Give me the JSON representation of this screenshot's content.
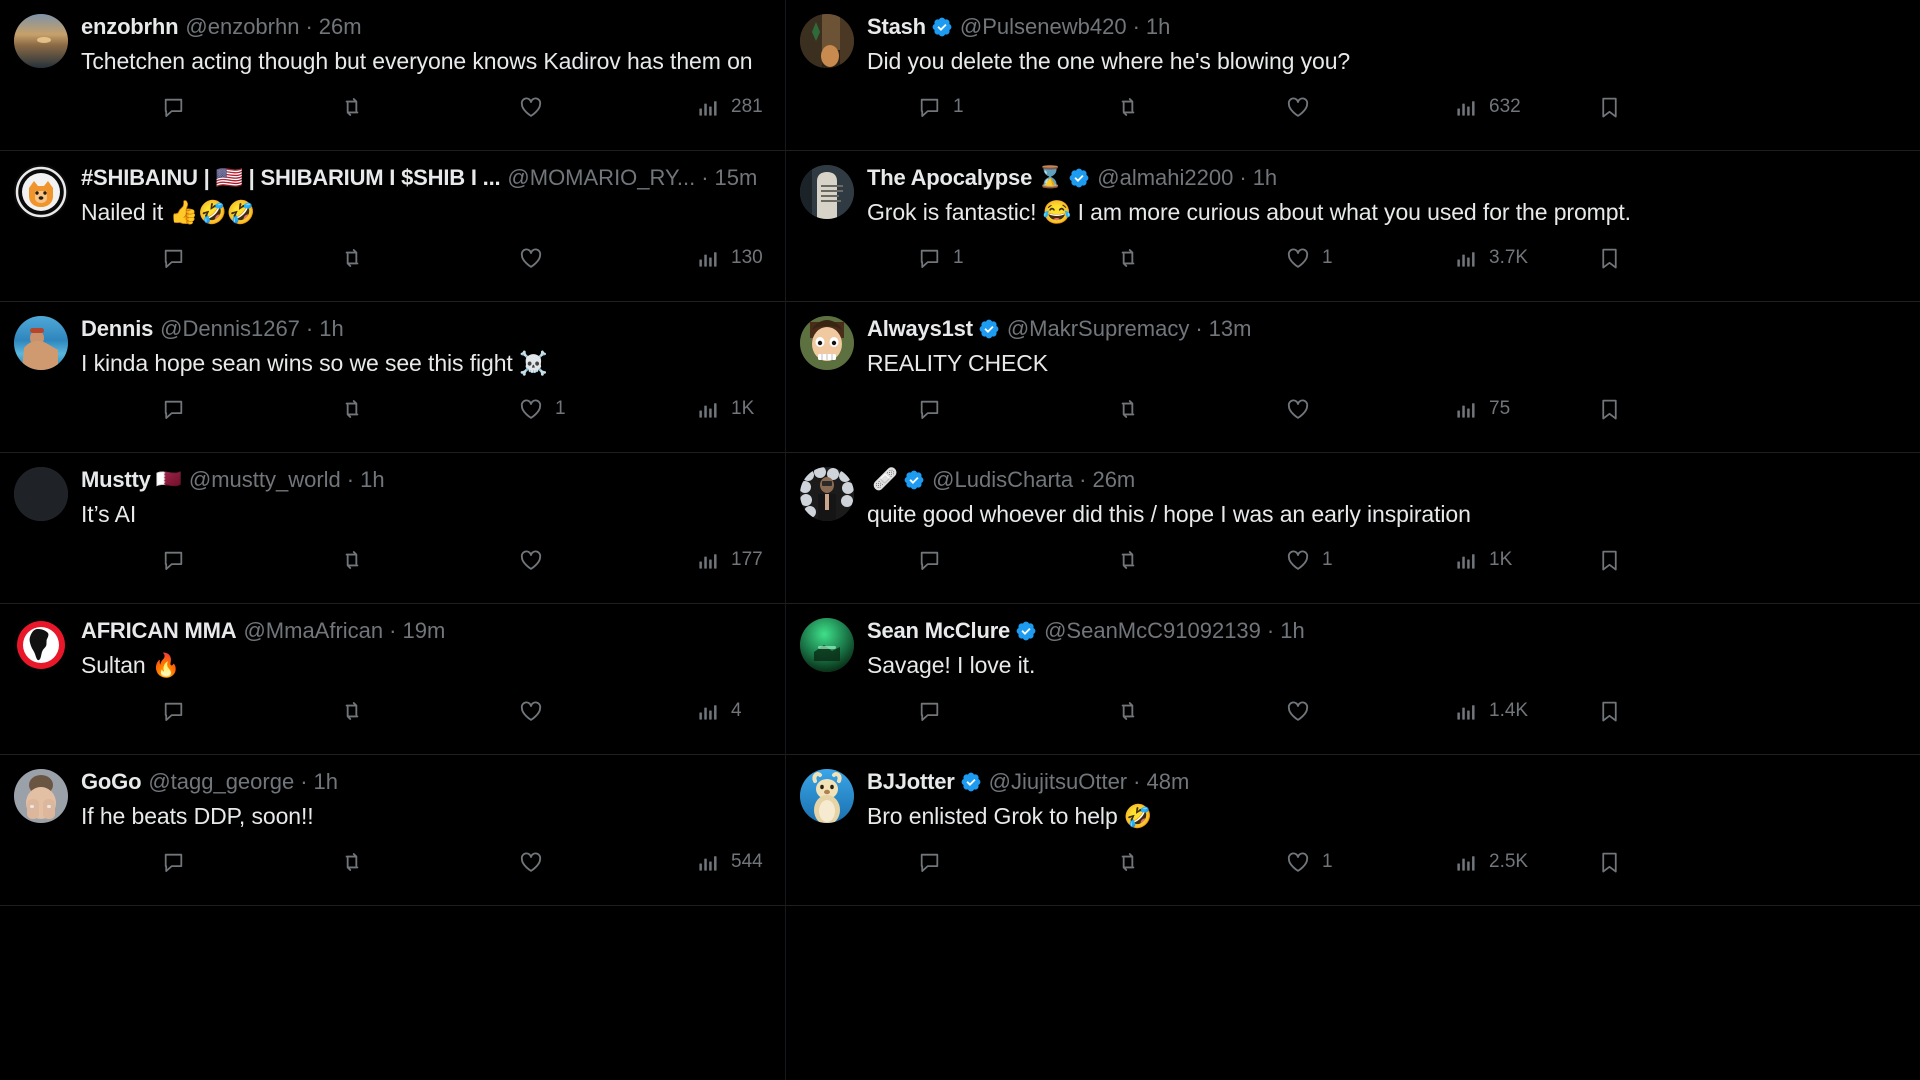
{
  "app": {
    "name": "x-timeline-replies",
    "theme": "dark",
    "accent_verified": "#1d9bf0",
    "text_primary": "#e7e9ea",
    "text_muted": "#71767b",
    "divider": "#1d1f23",
    "background": "#000000"
  },
  "icons": {
    "reply": "reply-icon",
    "retweet": "retweet-icon",
    "like": "heart-icon",
    "views": "analytics-bars-icon",
    "bookmark": "bookmark-icon",
    "verified": "verified-badge-icon",
    "close": "x-logo-icon"
  },
  "left_panel": {
    "name": "left-timeline-column",
    "tweets": [
      {
        "display_name": "enzobrhn",
        "name_emoji": "",
        "verified": false,
        "handle": "@enzobrhn",
        "time": "26m",
        "text": "Tchetchen acting though but everyone knows Kadirov has them on",
        "reply_count": "",
        "retweet_count": "",
        "like_count": "",
        "view_count": "281",
        "avatar_kind": "sunset-photo"
      },
      {
        "display_name": "#SHIBAINU | 🇺🇸 | SHIBARIUM I $SHIB I ...",
        "name_emoji": "",
        "verified": false,
        "handle": "@MOMARIO_RY...",
        "time": "15m",
        "text": "Nailed it 👍🤣🤣",
        "reply_count": "",
        "retweet_count": "",
        "like_count": "",
        "view_count": "130",
        "avatar_kind": "shiba-logo"
      },
      {
        "display_name": "Dennis",
        "name_emoji": "",
        "verified": false,
        "handle": "@Dennis1267",
        "time": "1h",
        "text": "I kinda hope sean wins so we see this fight ☠️",
        "reply_count": "",
        "retweet_count": "",
        "like_count": "1",
        "view_count": "1K",
        "avatar_kind": "beach-photo"
      },
      {
        "display_name": "Mustty",
        "name_emoji": "🇶🇦",
        "verified": false,
        "handle": "@mustty_world",
        "time": "1h",
        "text": "It’s AI",
        "reply_count": "",
        "retweet_count": "",
        "like_count": "",
        "view_count": "177",
        "avatar_kind": "blank-dark"
      },
      {
        "display_name": "AFRICAN MMA",
        "name_emoji": "",
        "verified": false,
        "handle": "@MmaAfrican",
        "time": "19m",
        "text": "Sultan 🔥",
        "reply_count": "",
        "retweet_count": "",
        "like_count": "",
        "view_count": "4",
        "avatar_kind": "africa-red-circle"
      },
      {
        "display_name": "GoGo",
        "name_emoji": "",
        "verified": false,
        "handle": "@tagg_george",
        "time": "1h",
        "text": "If he beats DDP, soon!!",
        "reply_count": "",
        "retweet_count": "",
        "like_count": "",
        "view_count": "544",
        "avatar_kind": "face-hands-photo"
      }
    ]
  },
  "right_panel": {
    "name": "right-timeline-column",
    "tweets": [
      {
        "display_name": "Stash",
        "name_emoji": "",
        "verified": true,
        "handle": "@Pulsenewb420",
        "time": "1h",
        "text": "Did you delete the one where he's blowing you?",
        "reply_count": "1",
        "retweet_count": "",
        "like_count": "",
        "view_count": "632",
        "avatar_kind": "indoor-photo"
      },
      {
        "display_name": "The Apocalypse",
        "name_emoji": "⌛",
        "verified": true,
        "handle": "@almahi2200",
        "time": "1h",
        "text": "Grok is fantastic! 😂 I am more curious about what you used for the prompt.",
        "reply_count": "1",
        "retweet_count": "",
        "like_count": "1",
        "view_count": "3.7K",
        "avatar_kind": "gravestone-photo"
      },
      {
        "display_name": "Always1st",
        "name_emoji": "",
        "verified": true,
        "handle": "@MakrSupremacy",
        "time": "13m",
        "text": "REALITY CHECK",
        "reply_count": "",
        "retweet_count": "",
        "like_count": "",
        "view_count": "75",
        "avatar_kind": "cartoon-face"
      },
      {
        "display_name": "",
        "name_emoji": "🩹",
        "verified": true,
        "handle": "@LudisCharta",
        "time": "26m",
        "text": "quite good whoever did this / hope I was an early inspiration",
        "reply_count": "",
        "retweet_count": "",
        "like_count": "1",
        "view_count": "1K",
        "avatar_kind": "balloons-photo"
      },
      {
        "display_name": "Sean McClure",
        "name_emoji": "",
        "verified": true,
        "handle": "@SeanMcC91092139",
        "time": "1h",
        "text": "Savage! I love it.",
        "reply_count": "",
        "retweet_count": "",
        "like_count": "",
        "view_count": "1.4K",
        "avatar_kind": "green-photo"
      },
      {
        "display_name": "BJJotter",
        "name_emoji": "",
        "verified": true,
        "handle": "@JiujitsuOtter",
        "time": "48m",
        "text": "Bro enlisted Grok to help 🤣",
        "reply_count": "",
        "retweet_count": "",
        "like_count": "1",
        "view_count": "2.5K",
        "avatar_kind": "otter-cartoon"
      }
    ]
  }
}
